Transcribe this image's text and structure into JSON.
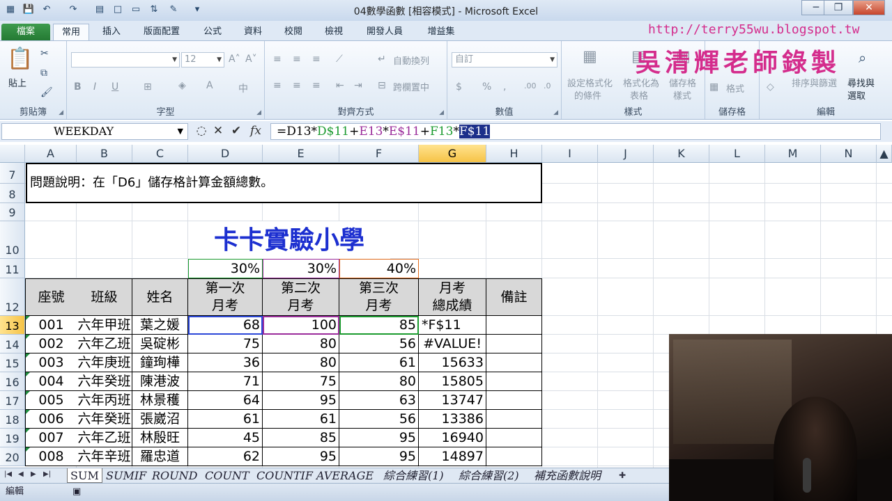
{
  "window": {
    "title": "04數學函數  [相容模式] - Microsoft Excel",
    "controls": {
      "minimize": "─",
      "maximize": "❐",
      "close": "✕"
    }
  },
  "ribbon_tabs": [
    "檔案",
    "常用",
    "插入",
    "版面配置",
    "公式",
    "資料",
    "校閱",
    "檢視",
    "開發人員",
    "增益集"
  ],
  "watermark": {
    "url": "http://terry55wu.blogspot.tw",
    "name": "吳清輝老師錄製"
  },
  "ribbon": {
    "clipboard": {
      "label": "剪貼簿",
      "paste": "貼上"
    },
    "font": {
      "label": "字型",
      "font_name": "",
      "font_size": "12"
    },
    "alignment": {
      "label": "對齊方式",
      "wrap_text": "自動換列",
      "merge_center": "跨欄置中"
    },
    "number": {
      "label": "數值",
      "format": "自訂"
    },
    "styles": {
      "label": "樣式",
      "conditional": [
        "設定格式化",
        "的條件"
      ],
      "format_table": [
        "格式化為",
        "表格"
      ],
      "cell_styles": [
        "儲存格",
        "樣式"
      ]
    },
    "cells": {
      "label": "儲存格",
      "format": "格式"
    },
    "editing": {
      "label": "編輯",
      "sort_filter": "排序與篩選",
      "find_select": [
        "尋找與",
        "選取"
      ]
    }
  },
  "formula_bar": {
    "name_box": "WEEKDAY",
    "formula_parts": [
      {
        "t": "=D13*",
        "c": "f-black"
      },
      {
        "t": "D$11",
        "c": "f-green"
      },
      {
        "t": "+",
        "c": "f-black"
      },
      {
        "t": "E13",
        "c": "f-purple"
      },
      {
        "t": "*",
        "c": "f-black"
      },
      {
        "t": "E$11",
        "c": "f-purple"
      },
      {
        "t": "+",
        "c": "f-black"
      },
      {
        "t": "F13",
        "c": "f-green"
      },
      {
        "t": "*",
        "c": "f-black"
      },
      {
        "t": "F$11",
        "c": "f-sel"
      }
    ]
  },
  "columns": [
    "A",
    "B",
    "C",
    "D",
    "E",
    "F",
    "G",
    "H",
    "I",
    "J",
    "K",
    "L",
    "M",
    "N"
  ],
  "rows": [
    "7",
    "8",
    "9",
    "10",
    "11",
    "12",
    "13",
    "14",
    "15",
    "16",
    "17",
    "18",
    "19",
    "20"
  ],
  "sheet": {
    "description": "問題說明：在「D6」儲存格計算金額總數。",
    "school_title": "卡卡實驗小學",
    "weights": [
      "30%",
      "30%",
      "40%"
    ],
    "table_headers": [
      "座號",
      "班級",
      "姓名",
      [
        "第一次",
        "月考"
      ],
      [
        "第二次",
        "月考"
      ],
      [
        "第三次",
        "月考"
      ],
      [
        "月考",
        "總成績"
      ],
      "備註"
    ],
    "rows": [
      {
        "no": "001",
        "cls": "六年甲班",
        "name": "葉之媛",
        "s1": "68",
        "s2": "100",
        "s3": "85",
        "total": "*F$11"
      },
      {
        "no": "002",
        "cls": "六年乙班",
        "name": "吳碇彬",
        "s1": "75",
        "s2": "80",
        "s3": "56",
        "total": "#VALUE!"
      },
      {
        "no": "003",
        "cls": "六年庚班",
        "name": "鐘珣樺",
        "s1": "36",
        "s2": "80",
        "s3": "61",
        "total": "15633"
      },
      {
        "no": "004",
        "cls": "六年癸班",
        "name": "陳港波",
        "s1": "71",
        "s2": "75",
        "s3": "80",
        "total": "15805"
      },
      {
        "no": "005",
        "cls": "六年丙班",
        "name": "林景穫",
        "s1": "64",
        "s2": "95",
        "s3": "63",
        "total": "13747"
      },
      {
        "no": "006",
        "cls": "六年癸班",
        "name": "張崴沼",
        "s1": "61",
        "s2": "61",
        "s3": "56",
        "total": "13386"
      },
      {
        "no": "007",
        "cls": "六年乙班",
        "name": "林殷旺",
        "s1": "45",
        "s2": "85",
        "s3": "95",
        "total": "16940"
      },
      {
        "no": "008",
        "cls": "六年辛班",
        "name": "羅忠道",
        "s1": "62",
        "s2": "95",
        "s3": "95",
        "total": "14897"
      }
    ]
  },
  "sheet_tabs": [
    "SUM",
    "SUMIF",
    "ROUND",
    "COUNT",
    "COUNTIF",
    "AVERAGE",
    "綜合練習(1)",
    "綜合練習(2)",
    "補充函數說明"
  ],
  "status": {
    "mode": "編輯"
  }
}
